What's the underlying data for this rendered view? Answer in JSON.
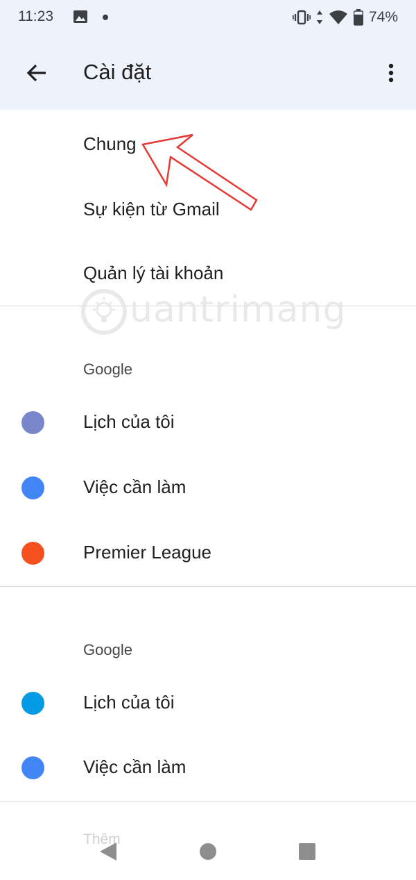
{
  "status_bar": {
    "time": "11:23",
    "battery_percent": "74%",
    "icons": [
      "gallery-icon",
      "notification-dot-icon",
      "vibrate-icon",
      "data-arrows-icon",
      "wifi-icon",
      "battery-icon"
    ]
  },
  "app_bar": {
    "title": "Cài đặt",
    "back_icon": "arrow-back-icon",
    "more_icon": "more-vert-icon",
    "background_color": "#eef2fa"
  },
  "general_items": [
    {
      "label": "Chung"
    },
    {
      "label": "Sự kiện từ Gmail"
    },
    {
      "label": "Quản lý tài khoản"
    }
  ],
  "account_sections": [
    {
      "header": "Google",
      "calendars": [
        {
          "label": "Lịch của tôi",
          "color": "#7986cb"
        },
        {
          "label": "Việc cần làm",
          "color": "#4285f4"
        },
        {
          "label": "Premier League",
          "color": "#f4511e"
        }
      ]
    },
    {
      "header": "Google",
      "calendars": [
        {
          "label": "Lịch của tôi",
          "color": "#039be5"
        },
        {
          "label": "Việc cần làm",
          "color": "#4285f4"
        }
      ]
    }
  ],
  "faded_more": "Thêm",
  "watermark": {
    "text": "uantrimang",
    "brand": "Quantrimang"
  },
  "annotation": {
    "color": "#e53935",
    "points_to": "Chung"
  },
  "nav_bar": {
    "buttons": [
      "back-triangle-icon",
      "home-circle-icon",
      "recents-square-icon"
    ]
  }
}
